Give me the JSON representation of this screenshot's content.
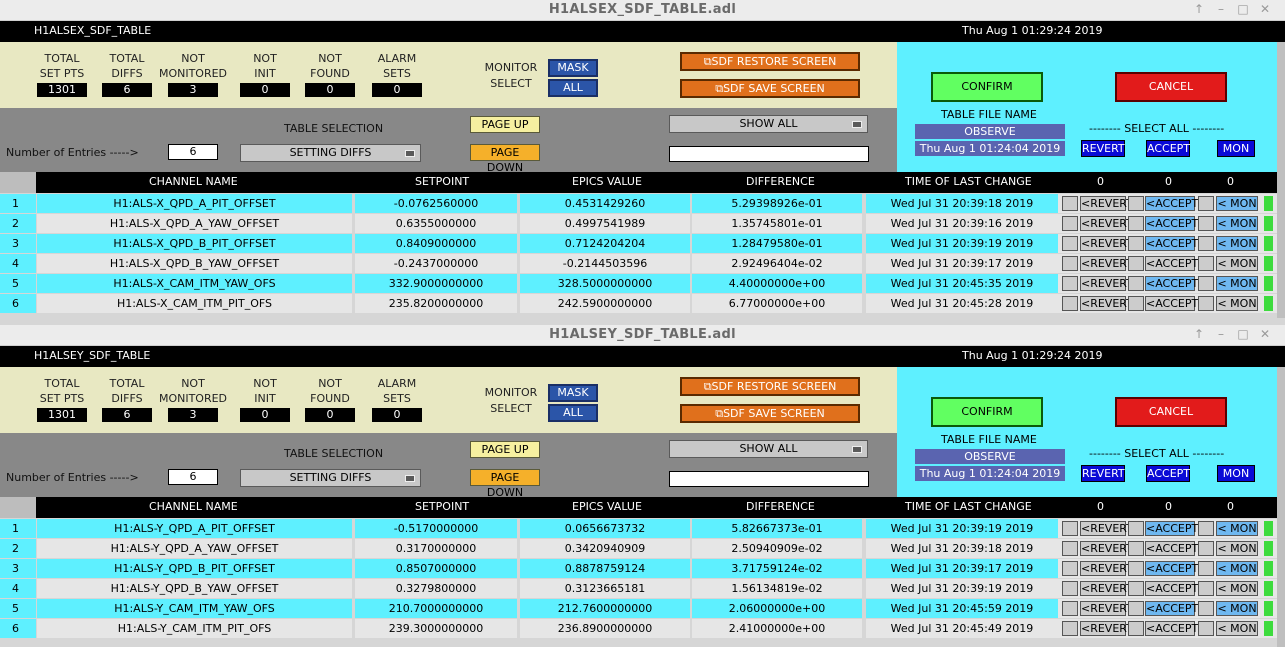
{
  "windows": [
    {
      "title": "H1ALSEX_SDF_TABLE.adl",
      "screen_name": "H1ALSEX_SDF_TABLE",
      "datetime": "Thu Aug  1 01:29:24 2019",
      "stats": [
        {
          "label": "TOTAL\nSET PTS",
          "value": "1301"
        },
        {
          "label": "TOTAL\nDIFFS",
          "value": "6"
        },
        {
          "label": "NOT\nMONITORED",
          "value": "3"
        },
        {
          "label": "NOT\nINIT",
          "value": "0"
        },
        {
          "label": "NOT\nFOUND",
          "value": "0"
        },
        {
          "label": "ALARM\nSETS",
          "value": "0"
        }
      ],
      "monitor_select": "MONITOR\nSELECT",
      "mask": "MASK",
      "all": "ALL",
      "sdf_restore": "⧉SDF RESTORE SCREEN",
      "sdf_save": "⧉SDF SAVE SCREEN",
      "confirm": "CONFIRM",
      "cancel": "CANCEL",
      "table_file_label": "TABLE FILE NAME",
      "table_file_name": "OBSERVE",
      "file_date": "Thu Aug  1 01:24:04 2019",
      "select_all": "-------- SELECT ALL --------",
      "revert_all": "REVERT",
      "accept_all": "ACCEPT",
      "mon_all": "MON",
      "table_selection": "TABLE SELECTION",
      "page_up": "PAGE UP",
      "page_down": "PAGE DOWN",
      "show_all": "SHOW ALL",
      "entries_label": "Number of Entries ----->",
      "entries": "6",
      "setting_diffs": "SETTING DIFFS",
      "filter": "",
      "headers": {
        "channel": "CHANNEL NAME",
        "setpoint": "SETPOINT",
        "epics": "EPICS VALUE",
        "diff": "DIFFERENCE",
        "time": "TIME OF LAST CHANGE",
        "c1": "0",
        "c2": "0",
        "c3": "0"
      },
      "row_btn": {
        "revert": "<REVERT",
        "accept": "<ACCEPT",
        "mon": "< MON"
      },
      "rows": [
        {
          "n": "1",
          "ch": "H1:ALS-X_QPD_A_PIT_OFFSET",
          "sp": "-0.0762560000",
          "ev": "0.4531429260",
          "df": "5.29398926e-01",
          "t": "Wed Jul 31 20:39:18 2019",
          "acc": true,
          "mon": true
        },
        {
          "n": "2",
          "ch": "H1:ALS-X_QPD_A_YAW_OFFSET",
          "sp": "0.6355000000",
          "ev": "0.4997541989",
          "df": "1.35745801e-01",
          "t": "Wed Jul 31 20:39:16 2019",
          "acc": true,
          "mon": true
        },
        {
          "n": "3",
          "ch": "H1:ALS-X_QPD_B_PIT_OFFSET",
          "sp": "0.8409000000",
          "ev": "0.7124204204",
          "df": "1.28479580e-01",
          "t": "Wed Jul 31 20:39:19 2019",
          "acc": true,
          "mon": true
        },
        {
          "n": "4",
          "ch": "H1:ALS-X_QPD_B_YAW_OFFSET",
          "sp": "-0.2437000000",
          "ev": "-0.2144503596",
          "df": "2.92496404e-02",
          "t": "Wed Jul 31 20:39:17 2019",
          "acc": false,
          "mon": false
        },
        {
          "n": "5",
          "ch": "H1:ALS-X_CAM_ITM_YAW_OFS",
          "sp": "332.9000000000",
          "ev": "328.5000000000",
          "df": "4.40000000e+00",
          "t": "Wed Jul 31 20:45:35 2019",
          "acc": true,
          "mon": true
        },
        {
          "n": "6",
          "ch": "H1:ALS-X_CAM_ITM_PIT_OFS",
          "sp": "235.8200000000",
          "ev": "242.5900000000",
          "df": "6.77000000e+00",
          "t": "Wed Jul 31 20:45:28 2019",
          "acc": false,
          "mon": false
        }
      ]
    },
    {
      "title": "H1ALSEY_SDF_TABLE.adl",
      "screen_name": "H1ALSEY_SDF_TABLE",
      "datetime": "Thu Aug  1 01:29:24 2019",
      "stats": [
        {
          "label": "TOTAL\nSET PTS",
          "value": "1301"
        },
        {
          "label": "TOTAL\nDIFFS",
          "value": "6"
        },
        {
          "label": "NOT\nMONITORED",
          "value": "3"
        },
        {
          "label": "NOT\nINIT",
          "value": "0"
        },
        {
          "label": "NOT\nFOUND",
          "value": "0"
        },
        {
          "label": "ALARM\nSETS",
          "value": "0"
        }
      ],
      "monitor_select": "MONITOR\nSELECT",
      "mask": "MASK",
      "all": "ALL",
      "sdf_restore": "⧉SDF RESTORE SCREEN",
      "sdf_save": "⧉SDF SAVE SCREEN",
      "confirm": "CONFIRM",
      "cancel": "CANCEL",
      "table_file_label": "TABLE FILE NAME",
      "table_file_name": "OBSERVE",
      "file_date": "Thu Aug  1 01:24:04 2019",
      "select_all": "-------- SELECT ALL --------",
      "revert_all": "REVERT",
      "accept_all": "ACCEPT",
      "mon_all": "MON",
      "table_selection": "TABLE SELECTION",
      "page_up": "PAGE UP",
      "page_down": "PAGE DOWN",
      "show_all": "SHOW ALL",
      "entries_label": "Number of Entries ----->",
      "entries": "6",
      "setting_diffs": "SETTING DIFFS",
      "filter": "",
      "headers": {
        "channel": "CHANNEL NAME",
        "setpoint": "SETPOINT",
        "epics": "EPICS VALUE",
        "diff": "DIFFERENCE",
        "time": "TIME OF LAST CHANGE",
        "c1": "0",
        "c2": "0",
        "c3": "0"
      },
      "row_btn": {
        "revert": "<REVERT",
        "accept": "<ACCEPT",
        "mon": "< MON"
      },
      "rows": [
        {
          "n": "1",
          "ch": "H1:ALS-Y_QPD_A_PIT_OFFSET",
          "sp": "-0.5170000000",
          "ev": "0.0656673732",
          "df": "5.82667373e-01",
          "t": "Wed Jul 31 20:39:19 2019",
          "acc": true,
          "mon": true
        },
        {
          "n": "2",
          "ch": "H1:ALS-Y_QPD_A_YAW_OFFSET",
          "sp": "0.3170000000",
          "ev": "0.3420940909",
          "df": "2.50940909e-02",
          "t": "Wed Jul 31 20:39:18 2019",
          "acc": false,
          "mon": false
        },
        {
          "n": "3",
          "ch": "H1:ALS-Y_QPD_B_PIT_OFFSET",
          "sp": "0.8507000000",
          "ev": "0.8878759124",
          "df": "3.71759124e-02",
          "t": "Wed Jul 31 20:39:17 2019",
          "acc": true,
          "mon": true
        },
        {
          "n": "4",
          "ch": "H1:ALS-Y_QPD_B_YAW_OFFSET",
          "sp": "0.3279800000",
          "ev": "0.3123665181",
          "df": "1.56134819e-02",
          "t": "Wed Jul 31 20:39:19 2019",
          "acc": false,
          "mon": false
        },
        {
          "n": "5",
          "ch": "H1:ALS-Y_CAM_ITM_YAW_OFS",
          "sp": "210.7000000000",
          "ev": "212.7600000000",
          "df": "2.06000000e+00",
          "t": "Wed Jul 31 20:45:59 2019",
          "acc": true,
          "mon": true
        },
        {
          "n": "6",
          "ch": "H1:ALS-Y_CAM_ITM_PIT_OFS",
          "sp": "239.3000000000",
          "ev": "236.8900000000",
          "df": "2.41000000e+00",
          "t": "Wed Jul 31 20:45:49 2019",
          "acc": false,
          "mon": false
        }
      ]
    }
  ]
}
